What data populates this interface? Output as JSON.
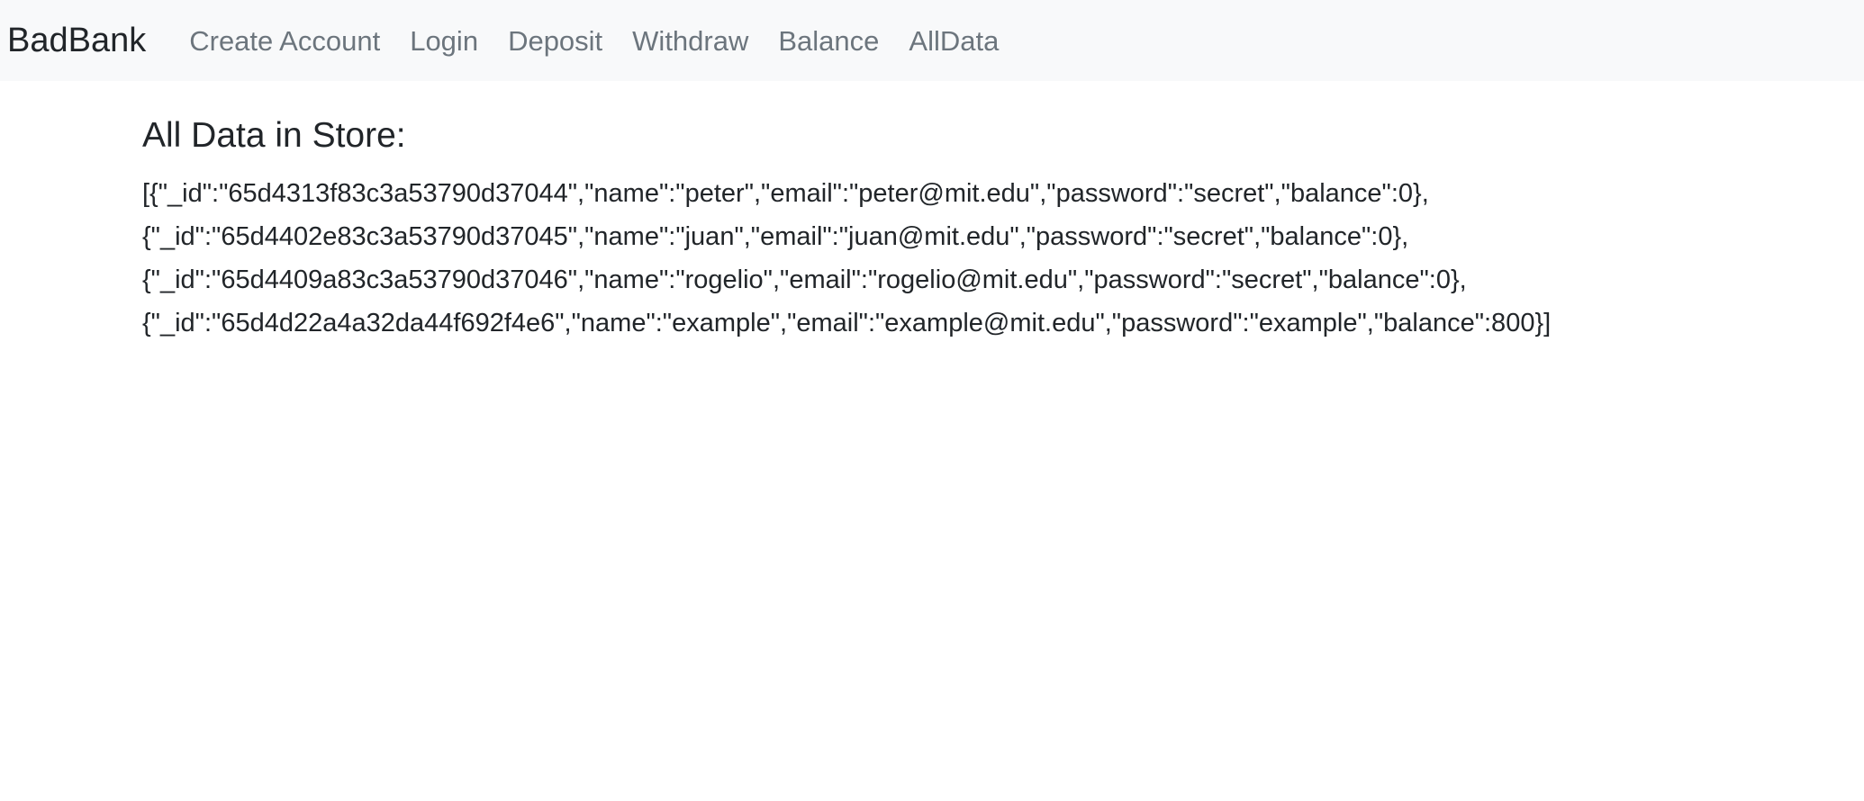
{
  "navbar": {
    "brand": "BadBank",
    "links": [
      {
        "label": "Create Account"
      },
      {
        "label": "Login"
      },
      {
        "label": "Deposit"
      },
      {
        "label": "Withdraw"
      },
      {
        "label": "Balance"
      },
      {
        "label": "AllData"
      }
    ]
  },
  "main": {
    "title": "All Data in Store:",
    "lines": [
      "[{\"_id\":\"65d4313f83c3a53790d37044\",\"name\":\"peter\",\"email\":\"peter@mit.edu\",\"password\":\"secret\",\"balance\":0},",
      "{\"_id\":\"65d4402e83c3a53790d37045\",\"name\":\"juan\",\"email\":\"juan@mit.edu\",\"password\":\"secret\",\"balance\":0},",
      "{\"_id\":\"65d4409a83c3a53790d37046\",\"name\":\"rogelio\",\"email\":\"rogelio@mit.edu\",\"password\":\"secret\",\"balance\":0},",
      "{\"_id\":\"65d4d22a4a32da44f692f4e6\",\"name\":\"example\",\"email\":\"example@mit.edu\",\"password\":\"example\",\"balance\":800}]"
    ]
  }
}
